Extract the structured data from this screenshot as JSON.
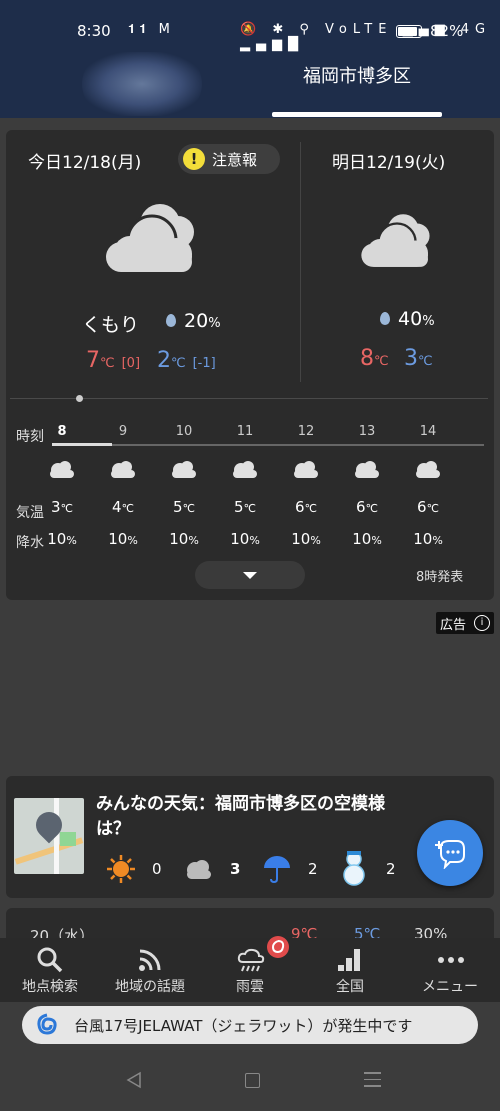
{
  "status_bar": {
    "time": "8:30",
    "battery": "82%",
    "left_icons": "𝟏𝟏 M",
    "right_icons": "🔕 ✱ ⚲ VoLTE ▂▄▆ 4G ▂▄▆█"
  },
  "header": {
    "location_tab": "福岡市博多区"
  },
  "today": {
    "title": "今日12/18(月)",
    "warning": "注意報",
    "warning_mark": "!",
    "condition": "くもり",
    "precip_value": "20",
    "precip_unit": "%",
    "high": "7",
    "high_unit": "℃",
    "high_diff": "[0]",
    "low": "2",
    "low_unit": "℃",
    "low_diff": "[-1]"
  },
  "tomorrow": {
    "title": "明日12/19(火)",
    "precip_value": "40",
    "precip_unit": "%",
    "high": "8",
    "high_unit": "℃",
    "low": "3",
    "low_unit": "℃"
  },
  "hourly": {
    "time_label": "時刻",
    "temp_label": "気温",
    "precip_label": "降水",
    "hours": [
      "8",
      "9",
      "10",
      "11",
      "12",
      "13",
      "14"
    ],
    "temps": [
      "3",
      "4",
      "5",
      "5",
      "6",
      "6",
      "6"
    ],
    "temp_unit": "℃",
    "precip": [
      "10",
      "10",
      "10",
      "10",
      "10",
      "10",
      "10"
    ],
    "precip_unit": "%",
    "issued": "8時発表"
  },
  "ad": {
    "label": "広告",
    "info_icon": "info-icon"
  },
  "community": {
    "title": "みんなの天気：福岡市博多区の空模様は？",
    "stats": [
      {
        "icon": "sun-icon",
        "count": "0"
      },
      {
        "icon": "cloud-icon",
        "count": "3"
      },
      {
        "icon": "umbrella-icon",
        "count": "2"
      },
      {
        "icon": "snowman-icon",
        "count": "2"
      }
    ]
  },
  "peek_row": {
    "date": "20（水）",
    "high": "9℃",
    "low": "5℃",
    "precip": "30%"
  },
  "bottom_nav": [
    {
      "label": "地点検索",
      "icon": "search-icon"
    },
    {
      "label": "地域の話題",
      "icon": "rss-icon"
    },
    {
      "label": "雨雲",
      "icon": "rain-cloud-icon"
    },
    {
      "label": "全国",
      "icon": "stairs-icon"
    },
    {
      "label": "メニュー",
      "icon": "more-icon"
    }
  ],
  "toast": {
    "text": "台風17号JELAWAT（ジェラワット）が発生中です"
  },
  "colors": {
    "header_bg": "#1e2d4a",
    "card_bg": "#2b2b2b",
    "high": "#e86664",
    "low": "#6c9be0",
    "fab": "#3b86e3",
    "warning": "#f3dd3a"
  }
}
